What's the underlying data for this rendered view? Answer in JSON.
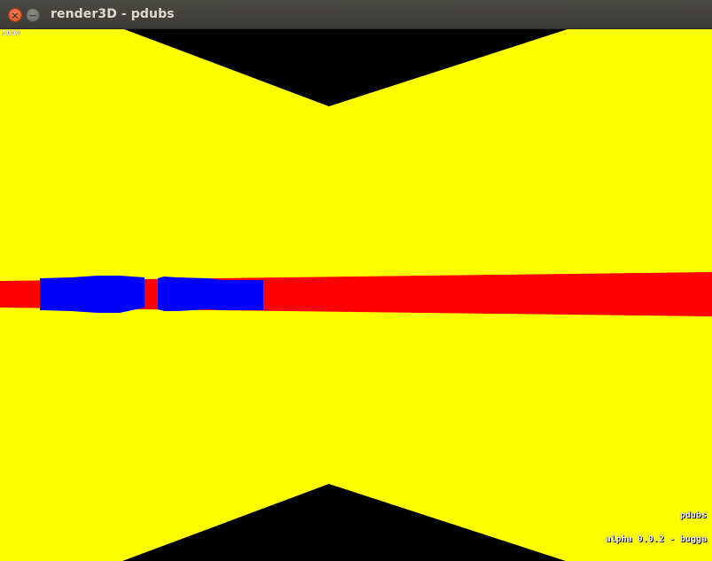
{
  "window": {
    "title": "render3D - pdubs",
    "close_glyph": "×",
    "minimize_glyph": "−"
  },
  "hud": {
    "fps_counter": "1000",
    "author": "pdubs",
    "build_label": "alpha 0.0.2 - bugga"
  },
  "scene": {
    "sky_color": "#000000",
    "wall_color": "#ffff00",
    "floor_stripe_color": "#ff0000",
    "object_color": "#0000ff"
  }
}
